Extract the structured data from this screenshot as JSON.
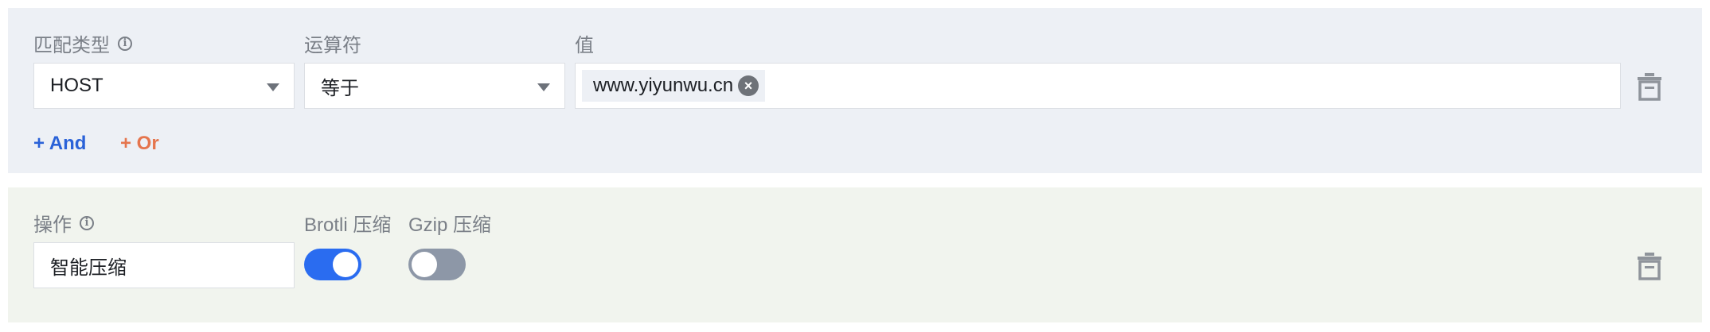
{
  "match_rule": {
    "type_label": "匹配类型",
    "operator_label": "运算符",
    "value_label": "值",
    "type_value": "HOST",
    "operator_value": "等于",
    "value_tags": [
      "www.yiyunwu.cn"
    ],
    "and_label": "+ And",
    "or_label": "+ Or"
  },
  "action_rule": {
    "operation_label": "操作",
    "operation_value": "智能压缩",
    "brotli_label": "Brotli 压缩",
    "gzip_label": "Gzip 压缩",
    "brotli_enabled": true,
    "gzip_enabled": false
  },
  "colors": {
    "accent": "#2a6cf0",
    "and_link": "#2a62d8",
    "or_link": "#e5754d",
    "match_panel": "#edf0f5",
    "action_panel": "#f1f4ee"
  },
  "icons": [
    "info-icon",
    "chevron-down-icon",
    "close-circle-icon",
    "trash-icon"
  ]
}
